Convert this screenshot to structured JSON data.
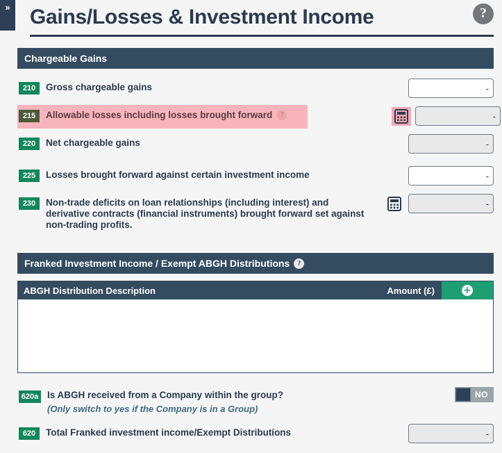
{
  "sidebar": {
    "toggle_icon": "chevron-double-right-icon",
    "toggle_label": "»"
  },
  "header": {
    "title": "Gains/Losses & Investment Income",
    "help_icon": "help-circle-icon",
    "help_label": "?"
  },
  "sections": [
    {
      "id": "chargeable-gains",
      "title": "Chargeable Gains",
      "has_help": false,
      "help_label": ""
    },
    {
      "id": "franked-investment-income",
      "title": "Franked Investment Income / Exempt ABGH Distributions",
      "has_help": true,
      "help_label": "?"
    }
  ],
  "chargeable_gains_rows": [
    {
      "box": "210",
      "label": "Gross chargeable gains",
      "highlighted": false,
      "has_label_help": false,
      "has_calculator": false,
      "input": {
        "value": "-",
        "placeholder": "",
        "readonly": false
      }
    },
    {
      "box": "215",
      "label": "Allowable losses including losses brought forward",
      "highlighted": true,
      "has_label_help": true,
      "label_help_label": "?",
      "has_calculator": true,
      "calculator_icon": "calculator-icon",
      "input": {
        "value": "-",
        "placeholder": "",
        "readonly": true
      }
    },
    {
      "box": "220",
      "label": "Net chargeable gains",
      "highlighted": false,
      "has_label_help": false,
      "has_calculator": false,
      "input": {
        "value": "-",
        "placeholder": "",
        "readonly": true
      }
    },
    {
      "box": "225",
      "label": "Losses brought forward against certain investment income",
      "highlighted": false,
      "has_label_help": false,
      "has_calculator": false,
      "input": {
        "value": "-",
        "placeholder": "",
        "readonly": false
      }
    },
    {
      "box": "230",
      "label": "Non-trade deficits on loan relationships (including interest) and derivative contracts (financial instruments) brought forward set against non-trading profits.",
      "highlighted": false,
      "has_label_help": false,
      "has_calculator": true,
      "calculator_icon": "calculator-icon",
      "input": {
        "value": "-",
        "placeholder": "",
        "readonly": true
      }
    }
  ],
  "abgh_grid": {
    "columns": [
      "ABGH Distribution Description",
      "Amount (£)"
    ],
    "add_button_label": "+",
    "add_button_icon": "plus-circle-icon",
    "rows": []
  },
  "franked_rows": [
    {
      "box": "620a",
      "label": "Is ABGH received from a Company within the group?",
      "note": "(Only switch to yes if the Company is in a Group)",
      "toggle": {
        "state": "NO",
        "on": false
      }
    },
    {
      "box": "620",
      "label": "Total Franked investment income/Exempt Distributions",
      "input": {
        "value": "-",
        "placeholder": "",
        "readonly": true
      }
    }
  ],
  "colors": {
    "navy": "#2e4057",
    "section_bar": "#344b60",
    "green_badge": "#13875c",
    "add_green": "#1f9e72",
    "highlight_pink": "#f7b5bb",
    "page_bg": "#f5f5f6"
  }
}
